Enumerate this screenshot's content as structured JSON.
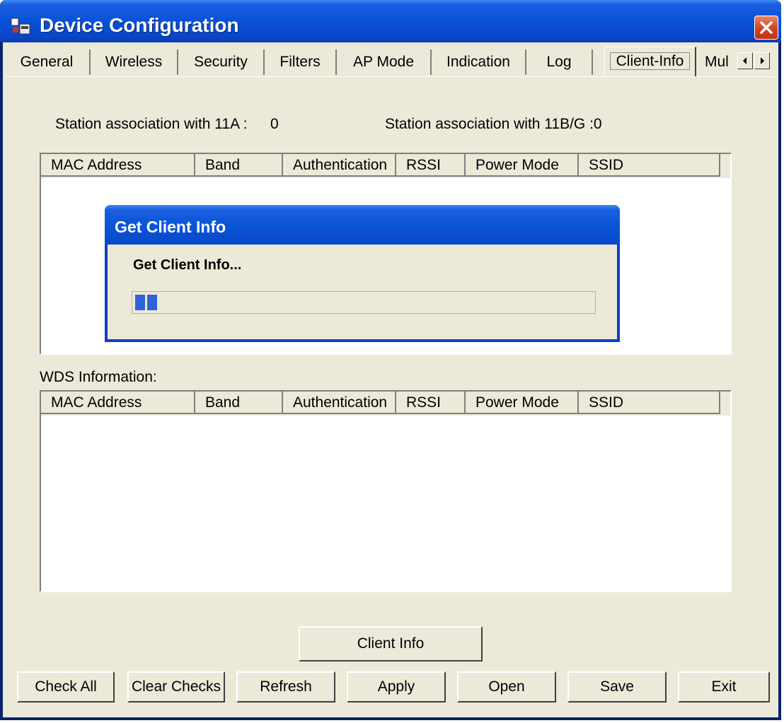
{
  "window": {
    "title": "Device Configuration"
  },
  "tabs": [
    {
      "label": "General"
    },
    {
      "label": "Wireless"
    },
    {
      "label": "Security"
    },
    {
      "label": "Filters"
    },
    {
      "label": "AP Mode"
    },
    {
      "label": "Indication"
    },
    {
      "label": "Log"
    },
    {
      "label": "Client-Info",
      "active": true
    },
    {
      "label": "Mul"
    }
  ],
  "association": {
    "a_label": "Station association with 11A :",
    "a_value": "0",
    "bg_label": "Station association with 11B/G :0"
  },
  "client_table": {
    "columns": [
      "MAC Address",
      "Band",
      "Authentication",
      "RSSI",
      "Power Mode",
      "SSID"
    ],
    "rows": []
  },
  "wds": {
    "label": "WDS Information:",
    "columns": [
      "MAC Address",
      "Band",
      "Authentication",
      "RSSI",
      "Power Mode",
      "SSID"
    ],
    "rows": []
  },
  "dialog": {
    "title": "Get Client Info",
    "message": "Get Client Info...",
    "progress_blocks": 2
  },
  "buttons": {
    "client_info": "Client Info",
    "check_all": "Check All",
    "clear_checks": "Clear Checks",
    "refresh": "Refresh",
    "apply": "Apply",
    "open": "Open",
    "save": "Save",
    "exit": "Exit"
  },
  "colors": {
    "titlebar": "#0851d8",
    "face": "#ece9d8",
    "close": "#d2431d",
    "progress": "#2f62d9"
  },
  "icons": [
    "app-icon",
    "close-icon",
    "scroll-left-icon",
    "scroll-right-icon"
  ]
}
